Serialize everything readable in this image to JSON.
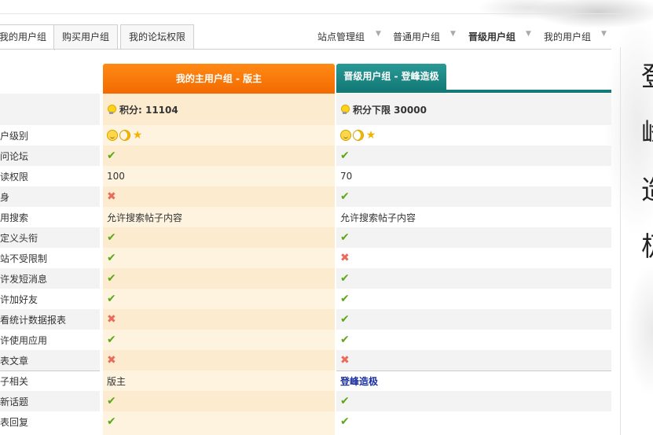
{
  "tabs": [
    {
      "label": "我的用户组",
      "active": true
    },
    {
      "label": "购买用户组",
      "active": false
    },
    {
      "label": "我的论坛权限",
      "active": false
    }
  ],
  "nav": [
    {
      "label": "站点管理组",
      "bold": false
    },
    {
      "label": "普通用户组",
      "bold": false
    },
    {
      "label": "晋级用户组",
      "bold": true
    },
    {
      "label": "我的用户组",
      "bold": false
    }
  ],
  "columns": {
    "a_title": "我的主用户组 - 版主",
    "b_title": "晋级用户组 - 登峰造极"
  },
  "score_row": {
    "a": "积分: 11104",
    "b": "积分下限 30000"
  },
  "side_chars": [
    "登",
    "峰",
    "造",
    "极"
  ],
  "rows": [
    {
      "label": "户级别",
      "a": "icons",
      "b": "icons"
    },
    {
      "label": "问论坛",
      "a": "check",
      "b": "check"
    },
    {
      "label": "读权限",
      "a": "100",
      "b": "70"
    },
    {
      "label": "身",
      "a": "cross",
      "b": "check"
    },
    {
      "label": "用搜索",
      "a": "允许搜索帖子内容",
      "b": "允许搜索帖子内容"
    },
    {
      "label": "定义头衔",
      "a": "check",
      "b": "check"
    },
    {
      "label": "站不受限制",
      "a": "check",
      "b": "cross"
    },
    {
      "label": "许发短消息",
      "a": "check",
      "b": "check"
    },
    {
      "label": "许加好友",
      "a": "check",
      "b": "check"
    },
    {
      "label": "看统计数据报表",
      "a": "cross",
      "b": "check"
    },
    {
      "label": "许使用应用",
      "a": "check",
      "b": "check"
    },
    {
      "label": "表文章",
      "a": "cross",
      "b": "cross"
    },
    {
      "label": "子相关",
      "a": "版主",
      "b": "登峰造极"
    },
    {
      "label": "新话题",
      "a": "check",
      "b": "check"
    },
    {
      "label": "表回复",
      "a": "check",
      "b": "check"
    }
  ],
  "colors": {
    "orange": "#f27a0a",
    "teal": "#137a77",
    "check": "#5da817",
    "cross": "#e86b5b"
  }
}
